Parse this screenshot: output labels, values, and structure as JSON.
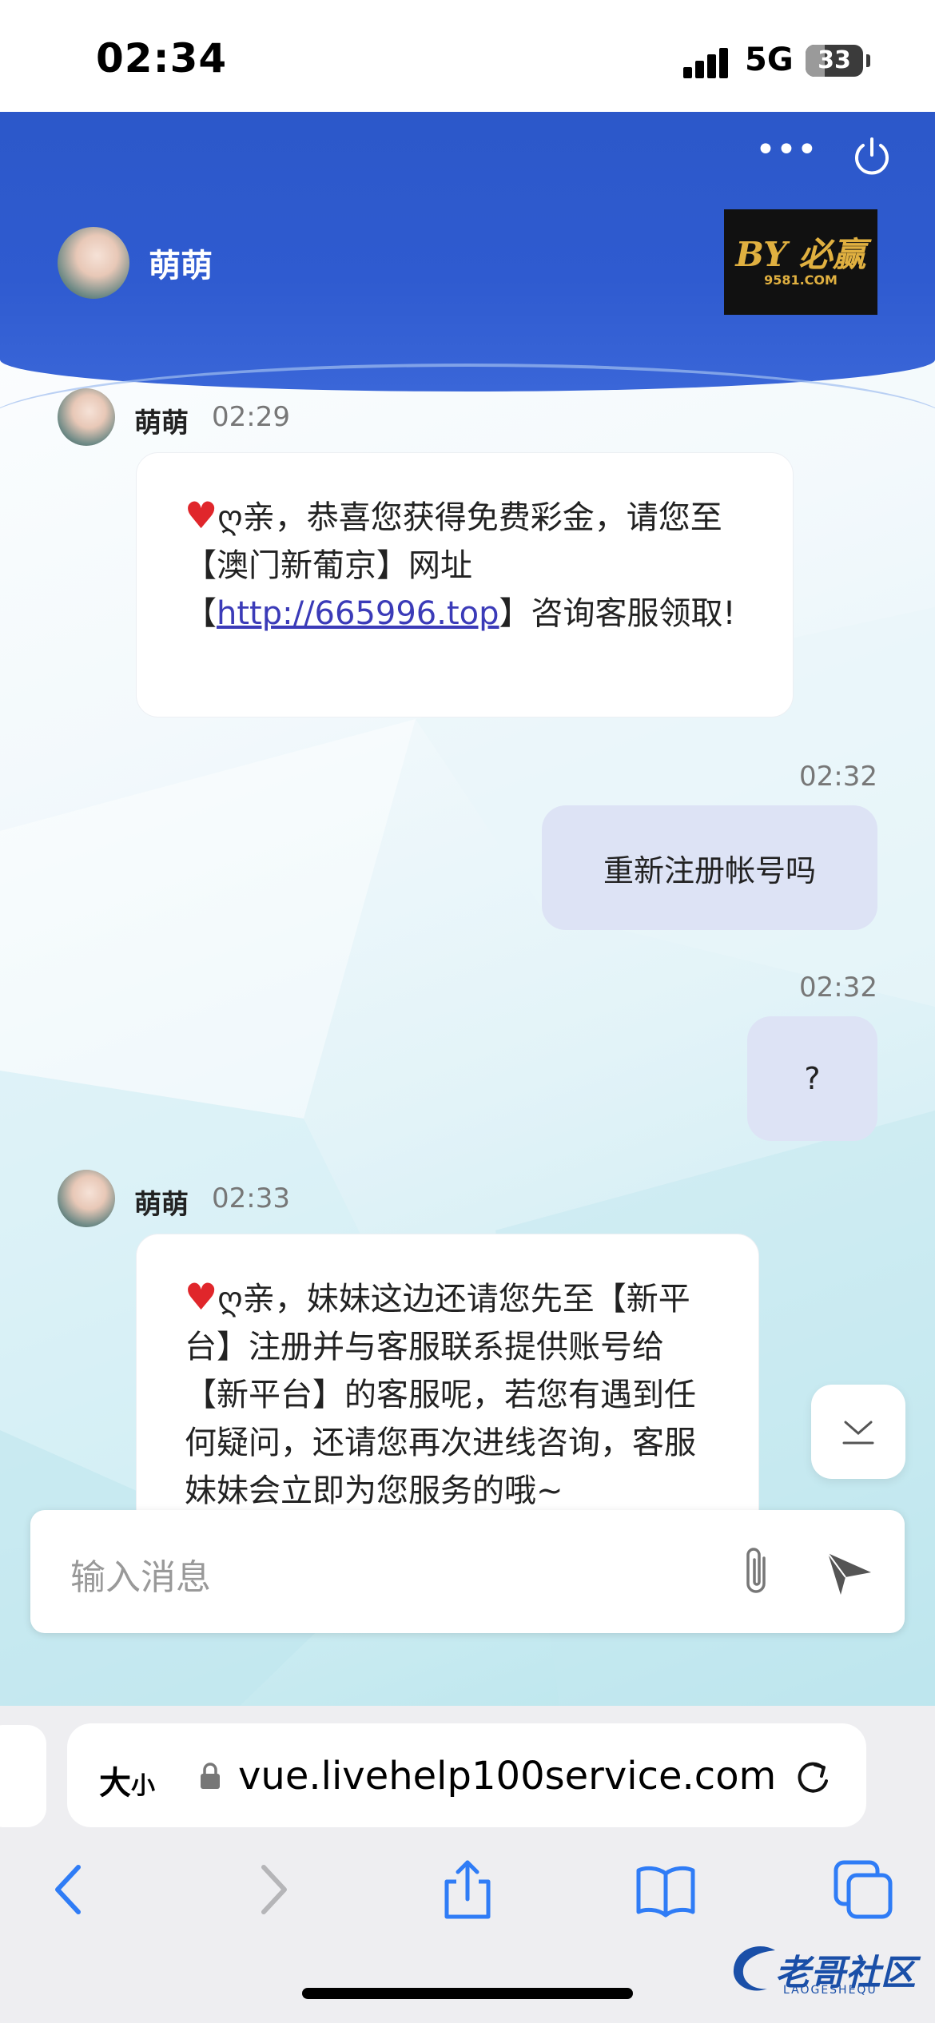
{
  "status_bar": {
    "time": "02:34",
    "network": "5G",
    "battery": "33"
  },
  "header": {
    "agent_name": "萌萌",
    "logo_main": "BY 必赢",
    "logo_sub": "9581.COM"
  },
  "messages": [
    {
      "sender": "萌萌",
      "time": "02:29",
      "prefix": "ღ",
      "text_before": "亲，恭喜您获得免费彩金，请您至【澳门新葡京】网址【",
      "link": "http://665996.top",
      "text_after": "】咨询客服领取!"
    },
    {
      "time": "02:32",
      "text": "重新注册帐号吗"
    },
    {
      "time": "02:32",
      "text": "?"
    },
    {
      "sender": "萌萌",
      "time": "02:33",
      "prefix": "ღ",
      "text": "亲，妹妹这边还请您先至【新平台】注册并与客服联系提供账号给【新平台】的客服呢，若您有遇到任何疑问，还请您再次进线咨询，客服妹妹会立即为您服务的哦~"
    }
  ],
  "input": {
    "placeholder": "输入消息"
  },
  "browser": {
    "text_size_label": "大",
    "text_size_small": "小",
    "url": "vue.livehelp100service.com"
  },
  "watermark": {
    "text": "老哥社区",
    "sub": "LAOGESHEQU"
  }
}
